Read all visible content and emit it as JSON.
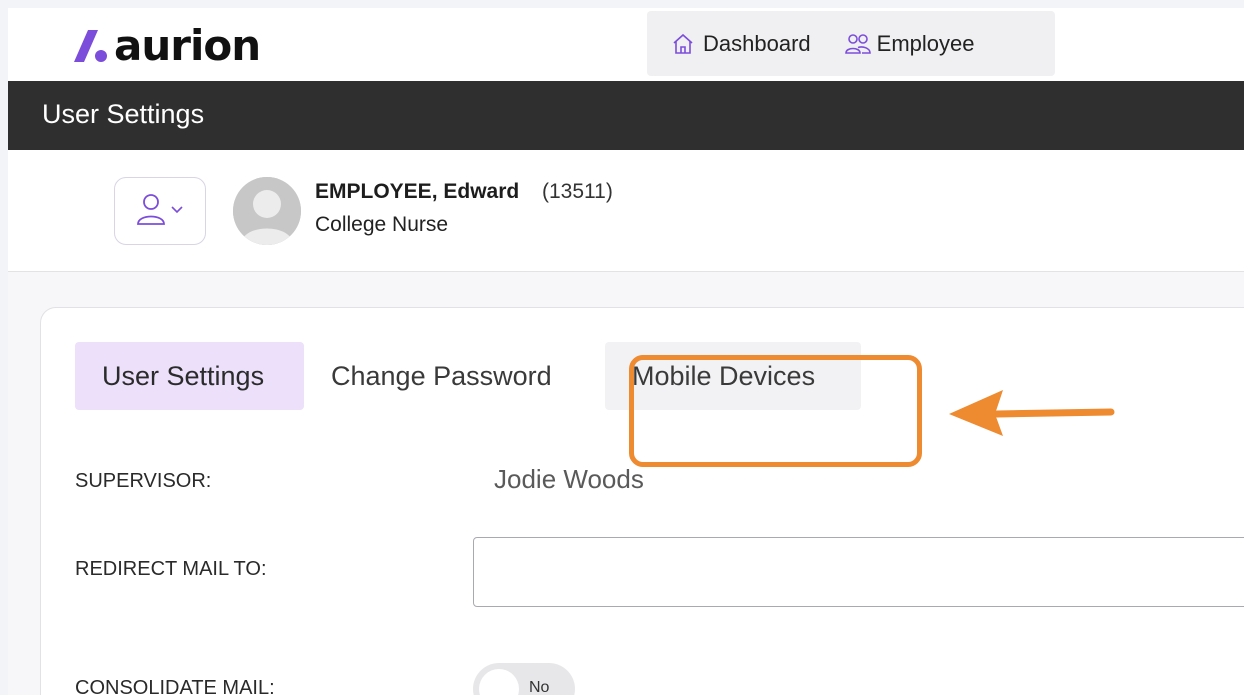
{
  "brand": {
    "name": "aurion",
    "accent": "#7c4ddb"
  },
  "topnav": {
    "items": [
      {
        "label": "Dashboard",
        "icon": "home-icon"
      },
      {
        "label": "Employee",
        "icon": "users-icon"
      }
    ]
  },
  "page": {
    "title": "User Settings"
  },
  "user": {
    "name": "EMPLOYEE, Edward",
    "id": "(13511)",
    "role": "College Nurse"
  },
  "tabs": [
    {
      "label": "User Settings",
      "active": true
    },
    {
      "label": "Change Password",
      "active": false
    },
    {
      "label": "Mobile Devices",
      "active": false
    }
  ],
  "fields": {
    "supervisor": {
      "label": "SUPERVISOR:",
      "value": "Jodie Woods"
    },
    "redirect_mail": {
      "label": "REDIRECT MAIL TO:",
      "value": "",
      "placeholder": ""
    },
    "consolidate_mail": {
      "label": "CONSOLIDATE MAIL:",
      "toggle": "No"
    }
  },
  "annotation": {
    "highlight_color": "#ee8a2f"
  }
}
